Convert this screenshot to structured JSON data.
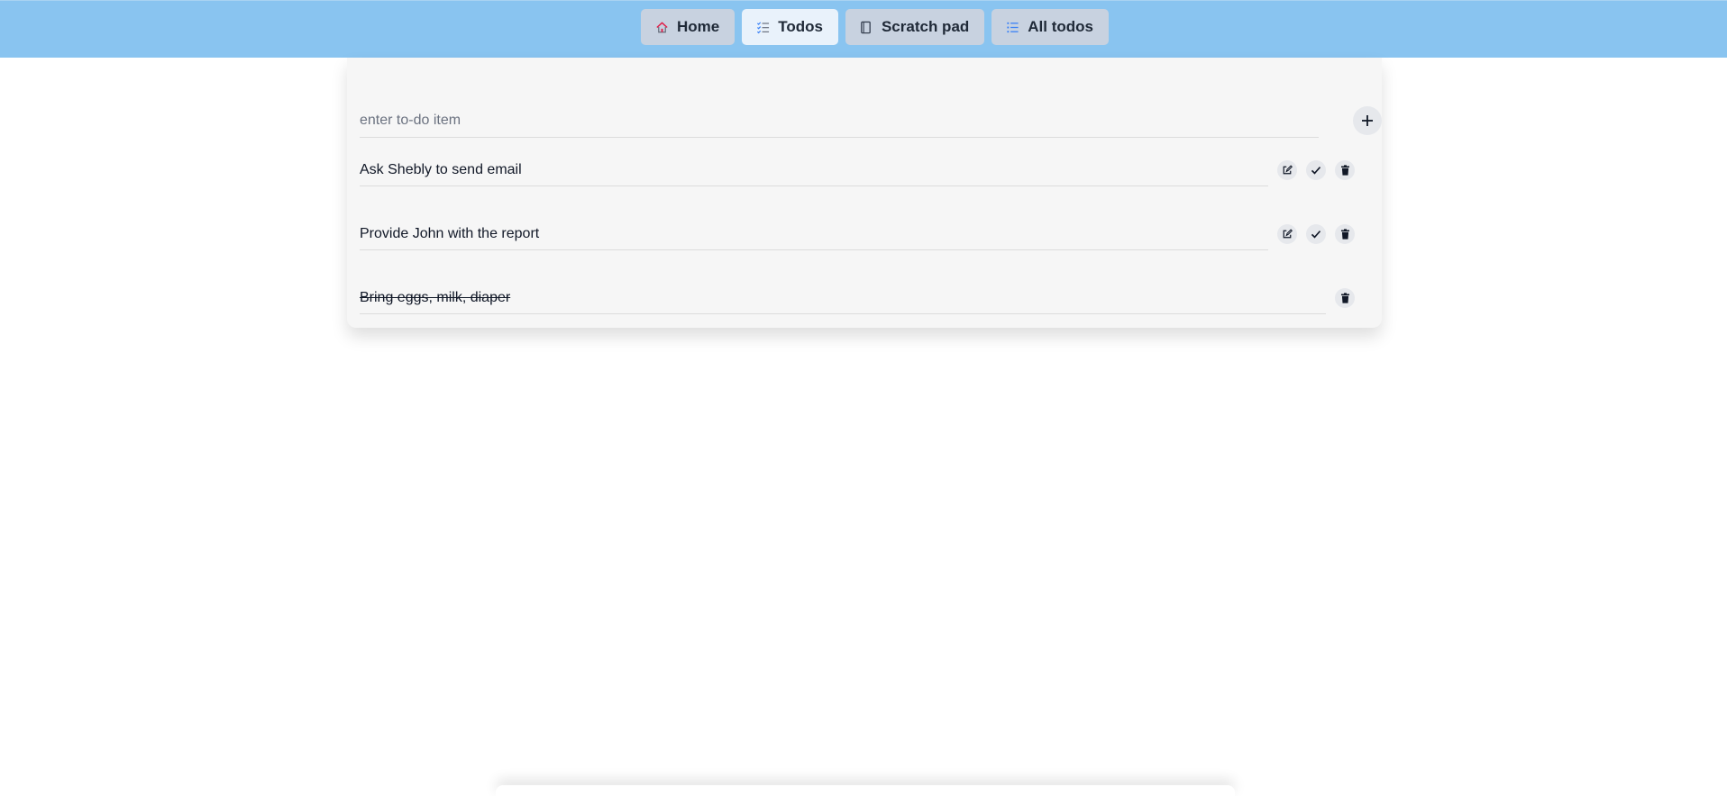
{
  "nav": {
    "items": [
      {
        "label": "Home",
        "icon": "home-icon",
        "active": false
      },
      {
        "label": "Todos",
        "icon": "checklist-icon",
        "active": true
      },
      {
        "label": "Scratch pad",
        "icon": "notebook-icon",
        "active": false
      },
      {
        "label": "All todos",
        "icon": "list-icon",
        "active": false
      }
    ]
  },
  "todo_form": {
    "placeholder": "enter to-do item",
    "value": ""
  },
  "todos": [
    {
      "text": "Ask Shebly to send email",
      "done": false
    },
    {
      "text": "Provide John with the report",
      "done": false
    },
    {
      "text": "Bring eggs, milk, diaper",
      "done": true
    }
  ],
  "colors": {
    "header": "#89c4f0",
    "nav_button": "#c8d2e0",
    "nav_button_active": "#e9f2fb",
    "card": "#f6f6f6",
    "home_icon": "#e11d48",
    "accent_icon": "#3b82f6"
  }
}
